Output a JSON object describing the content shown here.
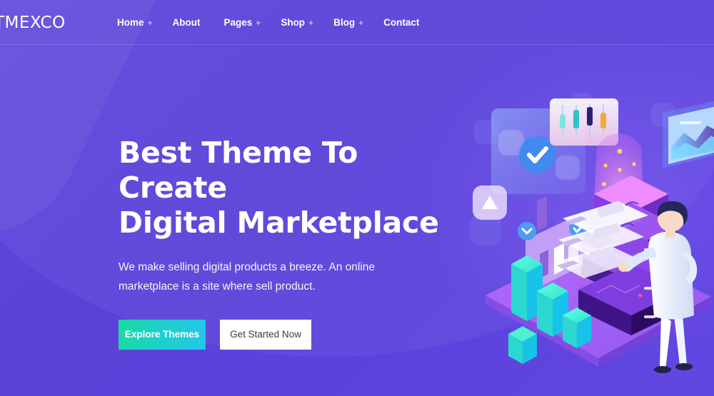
{
  "site": {
    "logo": "TMEXCO",
    "background_color": "#5A42D8",
    "accent_color": "#23C6EA"
  },
  "nav": {
    "items": [
      {
        "label": "Home",
        "has_submenu": true,
        "plus": "+"
      },
      {
        "label": "About",
        "has_submenu": false,
        "plus": ""
      },
      {
        "label": "Pages",
        "has_submenu": true,
        "plus": "+"
      },
      {
        "label": "Shop",
        "has_submenu": true,
        "plus": "+"
      },
      {
        "label": "Blog",
        "has_submenu": true,
        "plus": "+"
      },
      {
        "label": "Contact",
        "has_submenu": false,
        "plus": ""
      }
    ]
  },
  "hero": {
    "heading_line1": "Best Theme To Create",
    "heading_line2": "Digital Marketplace",
    "paragraph_line1": "We make selling digital products a breeze. An online",
    "paragraph_line2": "marketplace is a site where sell product.",
    "primary_button": "Explore Themes",
    "secondary_button": "Get Started Now",
    "primary_button_color": "#1FD0C8",
    "secondary_button_color": "#FFFFFF"
  },
  "illustration": {
    "name": "isometric-digital-marketplace-illustration",
    "elements": [
      "floating-checkmark-card",
      "candlestick-chart-card",
      "area-chart-card",
      "bar-chart-card",
      "glowing-server-tower",
      "particle-beam",
      "cyan-bar-chart",
      "isometric-platform",
      "person-figure",
      "floating-ui-panels"
    ]
  }
}
